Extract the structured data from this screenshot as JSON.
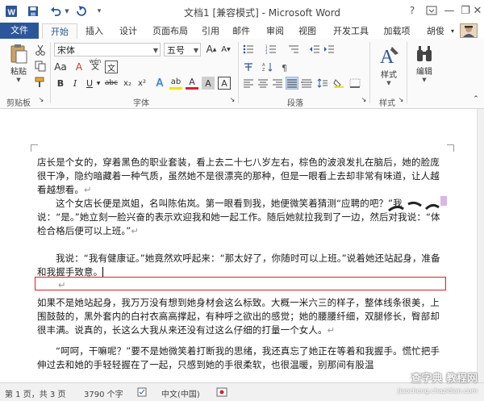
{
  "window": {
    "title": "文档1 [兼容模式] - Microsoft Word",
    "help": "?",
    "minimize": "—",
    "restore": "❐",
    "close": "✕"
  },
  "ribbon_tabs": [
    "文件",
    "开始",
    "插入",
    "设计",
    "页面布局",
    "引用",
    "邮件",
    "审阅",
    "视图",
    "开发工具",
    "加载项",
    "胡俊"
  ],
  "clipboard": {
    "paste_label": "粘贴",
    "group_label": "剪贴板"
  },
  "font": {
    "name": "宋体",
    "size": "五号",
    "group_label": "字体",
    "grow": "A",
    "shrink": "A",
    "case": "Aa",
    "clear": "A",
    "wen": "wén",
    "wen2": "文",
    "bold": "B",
    "italic": "I",
    "underline": "U",
    "strike": "abc",
    "sub": "x₂",
    "sup": "x²",
    "effects": "A",
    "highlight": "ab",
    "color": "A",
    "shade": "A",
    "border": "A"
  },
  "paragraph": {
    "group_label": "段落"
  },
  "styles": {
    "label": "样式",
    "group_label": "样式"
  },
  "editing": {
    "label": "编辑"
  },
  "document": {
    "paragraphs": [
      "店长是个女的，穿着黑色的职业套装，看上去二十七八岁左右，棕色的波浪发扎在脑后，她的脸庞很干净，隐约暗藏着一种气质，虽然她不是很漂亮的那种，但是一眼看上去却非常有味道，让人越看越想看。",
      "这个女店长便是岚姐，名叫陈佑岚。第一眼看到我，她便微笑着猜测“应聘的吧？”我说：“是。”她立刻一脸兴奋的表示欢迎我和她一起工作。随后她就拉我到了一边，然后对我说：“体检合格后便可以上班。”",
      "我说：“我有健康证。”她竟然欢呼起来：“那太好了，你随时可以上班。”说着她还站起身，准备和我握手致意。",
      "",
      "如果不是她站起身，我万万没有想到她身材会这么标致。大概一米六三的样子，整体线条很美，上围鼓鼓的，黑外套内的白衬衣高高撑起，有种呼之欲出的感觉；她的腰腰纤细，双腿修长，臀部却很丰满。说真的，长这么大我从来还没有过这么仔细的打量一个女人。",
      "“呵呵，干嘛呢？”要不是她微笑着打断我的思绪，我还真忘了她正在等着和我握手。慌忙把手伸过去和她的手轻轻握在了一起，只感到她的手很柔软，也很温暖，别那间有股温"
    ],
    "para_mark": "↵"
  },
  "status": {
    "page": "第 1 页，共 3 页",
    "words": "3790 个字",
    "lang": "中文(中国)"
  },
  "watermark": {
    "line1": "查字典 教程网",
    "line2": "jiaocheng.chazidian.com"
  },
  "colors": {
    "accent": "#2b579a",
    "highlight_box": "#d0242c"
  }
}
